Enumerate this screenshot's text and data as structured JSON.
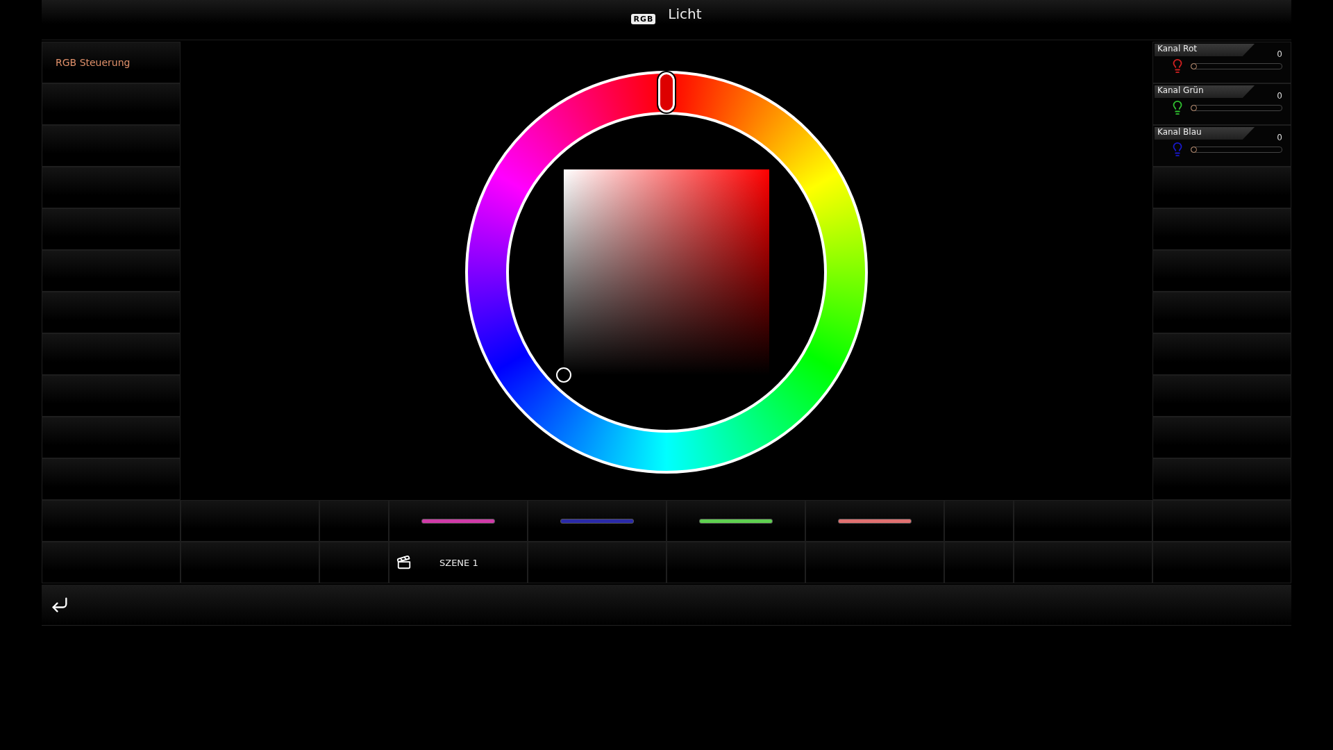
{
  "header": {
    "badge": "RGB",
    "title": "Licht"
  },
  "sidebar": {
    "items": [
      {
        "label": "RGB Steuerung",
        "selected": true
      }
    ]
  },
  "channels": [
    {
      "name": "Kanal Rot",
      "value": "0",
      "level": 0,
      "color": "#d02020"
    },
    {
      "name": "Kanal Grün",
      "value": "0",
      "level": 0,
      "color": "#30c030"
    },
    {
      "name": "Kanal Blau",
      "value": "0",
      "level": 0,
      "color": "#1818c8"
    }
  ],
  "swatches": [
    {
      "color": "#d03aa8"
    },
    {
      "color": "#2a2aa8"
    },
    {
      "color": "#5fd050"
    },
    {
      "color": "#e07070"
    }
  ],
  "scenes": [
    {
      "label": "SZENE 1"
    }
  ]
}
